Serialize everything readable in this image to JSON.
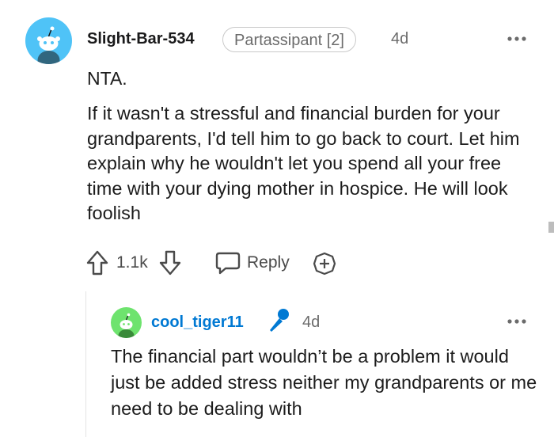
{
  "comment": {
    "username": "Slight-Bar-534",
    "flair": "Partassipant [2]",
    "time": "4d",
    "headline": "NTA.",
    "body": "If it wasn't a stressful and financial burden for your grandparents, I'd tell him to go back to court. Let him explain why he wouldn't let you spend all your free time with your dying mother in hospice. He will look foolish",
    "more_icon": "more-dots-icon"
  },
  "actions": {
    "score": "1.1k",
    "reply_label": "Reply",
    "upvote_icon": "upvote-arrow-icon",
    "downvote_icon": "downvote-arrow-icon",
    "reply_icon": "speech-bubble-icon",
    "award_icon": "award-plus-icon"
  },
  "reply": {
    "username": "cool_tiger11",
    "badge_icon": "microphone-icon",
    "time": "4d",
    "body": "The financial part wouldn’t be a problem it would just be added stress neither my grandparents or me need to be dealing with",
    "more_icon": "more-dots-icon"
  },
  "colors": {
    "avatar1": "#4fc3f7",
    "avatar2": "#6ee36e",
    "reply_username": "#0079d3",
    "mic_badge": "#0079d3",
    "meta_text": "#6b6b6b"
  }
}
